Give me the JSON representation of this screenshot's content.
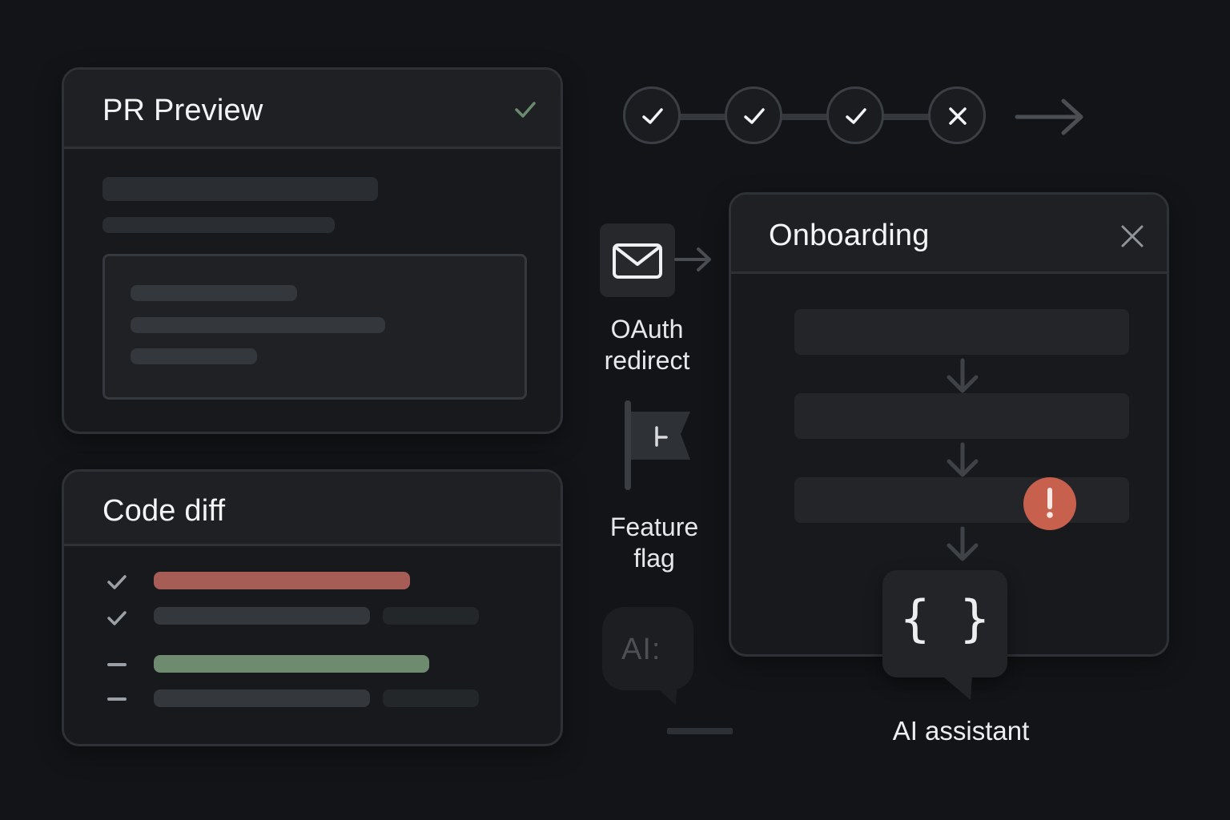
{
  "pr_preview": {
    "title": "PR Preview",
    "status_icon": "check-icon"
  },
  "pipeline": {
    "steps": [
      {
        "status": "passed",
        "icon": "check-icon"
      },
      {
        "status": "passed",
        "icon": "check-icon"
      },
      {
        "status": "passed",
        "icon": "check-icon"
      },
      {
        "status": "failed",
        "icon": "x-icon"
      }
    ],
    "next_icon": "arrow-right-icon"
  },
  "onboarding": {
    "title": "Onboarding",
    "close_icon": "close-icon",
    "warning_icon": "exclamation-icon"
  },
  "code_diff": {
    "title": "Code diff",
    "lines": [
      {
        "marker": "check",
        "change": "removed"
      },
      {
        "marker": "check",
        "change": "unchanged"
      },
      {
        "marker": "dash",
        "change": "added"
      },
      {
        "marker": "dash",
        "change": "unchanged"
      }
    ]
  },
  "sidebar": {
    "oauth_label_line1": "OAuth",
    "oauth_label_line2": "redirect",
    "feature_flag_label_line1": "Feature",
    "feature_flag_label_line2": "flag",
    "ai_bubble_text": "AI:"
  },
  "ai_assistant": {
    "label": "AI assistant",
    "glyph": "{ }"
  },
  "colors": {
    "background": "#121417",
    "removed": "#a65d55",
    "added": "#6e8a6f",
    "warning": "#c8604e",
    "check_green": "#6a8b6e"
  }
}
